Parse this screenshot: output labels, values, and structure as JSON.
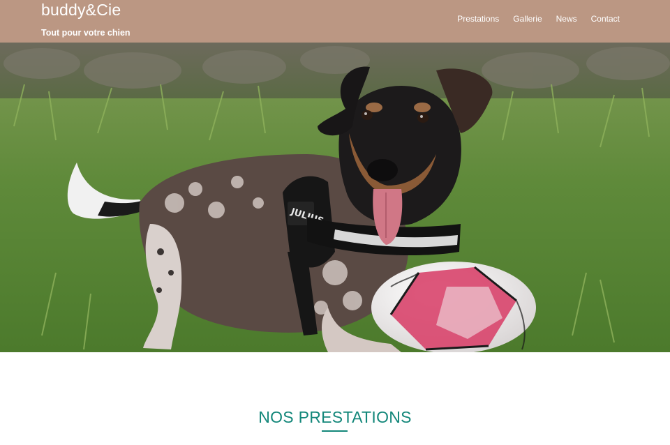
{
  "brand": {
    "title": "buddy&Cie",
    "tagline": "Tout pour votre chien"
  },
  "nav": {
    "items": [
      {
        "label": "Prestations"
      },
      {
        "label": "Gallerie"
      },
      {
        "label": "News"
      },
      {
        "label": "Contact"
      }
    ]
  },
  "hero": {
    "image_subject": "dog-lying-in-grass-with-ball",
    "harness_text": "JULIUS"
  },
  "section": {
    "title": "NOS PRESTATIONS"
  },
  "colors": {
    "header_bg": "#a87a60",
    "accent": "#13877a",
    "text_light": "#ffffff"
  }
}
